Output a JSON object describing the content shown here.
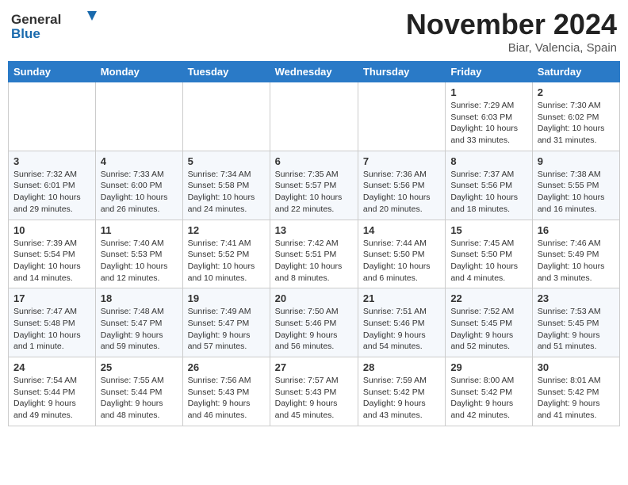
{
  "header": {
    "logo_general": "General",
    "logo_blue": "Blue",
    "month": "November 2024",
    "location": "Biar, Valencia, Spain"
  },
  "weekdays": [
    "Sunday",
    "Monday",
    "Tuesday",
    "Wednesday",
    "Thursday",
    "Friday",
    "Saturday"
  ],
  "weeks": [
    [
      {
        "day": "",
        "info": ""
      },
      {
        "day": "",
        "info": ""
      },
      {
        "day": "",
        "info": ""
      },
      {
        "day": "",
        "info": ""
      },
      {
        "day": "",
        "info": ""
      },
      {
        "day": "1",
        "info": "Sunrise: 7:29 AM\nSunset: 6:03 PM\nDaylight: 10 hours and 33 minutes."
      },
      {
        "day": "2",
        "info": "Sunrise: 7:30 AM\nSunset: 6:02 PM\nDaylight: 10 hours and 31 minutes."
      }
    ],
    [
      {
        "day": "3",
        "info": "Sunrise: 7:32 AM\nSunset: 6:01 PM\nDaylight: 10 hours and 29 minutes."
      },
      {
        "day": "4",
        "info": "Sunrise: 7:33 AM\nSunset: 6:00 PM\nDaylight: 10 hours and 26 minutes."
      },
      {
        "day": "5",
        "info": "Sunrise: 7:34 AM\nSunset: 5:58 PM\nDaylight: 10 hours and 24 minutes."
      },
      {
        "day": "6",
        "info": "Sunrise: 7:35 AM\nSunset: 5:57 PM\nDaylight: 10 hours and 22 minutes."
      },
      {
        "day": "7",
        "info": "Sunrise: 7:36 AM\nSunset: 5:56 PM\nDaylight: 10 hours and 20 minutes."
      },
      {
        "day": "8",
        "info": "Sunrise: 7:37 AM\nSunset: 5:56 PM\nDaylight: 10 hours and 18 minutes."
      },
      {
        "day": "9",
        "info": "Sunrise: 7:38 AM\nSunset: 5:55 PM\nDaylight: 10 hours and 16 minutes."
      }
    ],
    [
      {
        "day": "10",
        "info": "Sunrise: 7:39 AM\nSunset: 5:54 PM\nDaylight: 10 hours and 14 minutes."
      },
      {
        "day": "11",
        "info": "Sunrise: 7:40 AM\nSunset: 5:53 PM\nDaylight: 10 hours and 12 minutes."
      },
      {
        "day": "12",
        "info": "Sunrise: 7:41 AM\nSunset: 5:52 PM\nDaylight: 10 hours and 10 minutes."
      },
      {
        "day": "13",
        "info": "Sunrise: 7:42 AM\nSunset: 5:51 PM\nDaylight: 10 hours and 8 minutes."
      },
      {
        "day": "14",
        "info": "Sunrise: 7:44 AM\nSunset: 5:50 PM\nDaylight: 10 hours and 6 minutes."
      },
      {
        "day": "15",
        "info": "Sunrise: 7:45 AM\nSunset: 5:50 PM\nDaylight: 10 hours and 4 minutes."
      },
      {
        "day": "16",
        "info": "Sunrise: 7:46 AM\nSunset: 5:49 PM\nDaylight: 10 hours and 3 minutes."
      }
    ],
    [
      {
        "day": "17",
        "info": "Sunrise: 7:47 AM\nSunset: 5:48 PM\nDaylight: 10 hours and 1 minute."
      },
      {
        "day": "18",
        "info": "Sunrise: 7:48 AM\nSunset: 5:47 PM\nDaylight: 9 hours and 59 minutes."
      },
      {
        "day": "19",
        "info": "Sunrise: 7:49 AM\nSunset: 5:47 PM\nDaylight: 9 hours and 57 minutes."
      },
      {
        "day": "20",
        "info": "Sunrise: 7:50 AM\nSunset: 5:46 PM\nDaylight: 9 hours and 56 minutes."
      },
      {
        "day": "21",
        "info": "Sunrise: 7:51 AM\nSunset: 5:46 PM\nDaylight: 9 hours and 54 minutes."
      },
      {
        "day": "22",
        "info": "Sunrise: 7:52 AM\nSunset: 5:45 PM\nDaylight: 9 hours and 52 minutes."
      },
      {
        "day": "23",
        "info": "Sunrise: 7:53 AM\nSunset: 5:45 PM\nDaylight: 9 hours and 51 minutes."
      }
    ],
    [
      {
        "day": "24",
        "info": "Sunrise: 7:54 AM\nSunset: 5:44 PM\nDaylight: 9 hours and 49 minutes."
      },
      {
        "day": "25",
        "info": "Sunrise: 7:55 AM\nSunset: 5:44 PM\nDaylight: 9 hours and 48 minutes."
      },
      {
        "day": "26",
        "info": "Sunrise: 7:56 AM\nSunset: 5:43 PM\nDaylight: 9 hours and 46 minutes."
      },
      {
        "day": "27",
        "info": "Sunrise: 7:57 AM\nSunset: 5:43 PM\nDaylight: 9 hours and 45 minutes."
      },
      {
        "day": "28",
        "info": "Sunrise: 7:59 AM\nSunset: 5:42 PM\nDaylight: 9 hours and 43 minutes."
      },
      {
        "day": "29",
        "info": "Sunrise: 8:00 AM\nSunset: 5:42 PM\nDaylight: 9 hours and 42 minutes."
      },
      {
        "day": "30",
        "info": "Sunrise: 8:01 AM\nSunset: 5:42 PM\nDaylight: 9 hours and 41 minutes."
      }
    ]
  ]
}
